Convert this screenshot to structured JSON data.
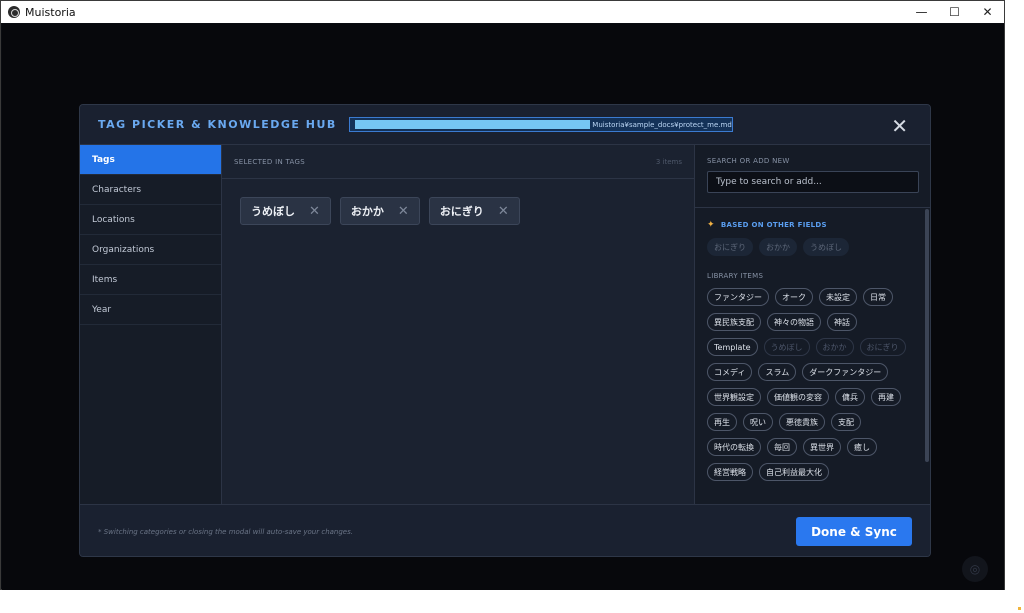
{
  "window": {
    "title": "Muistoria",
    "minimize_glyph": "—",
    "maximize_glyph": "☐",
    "close_glyph": "✕"
  },
  "modal": {
    "title": "TAG PICKER & KNOWLEDGE HUB",
    "path": "Muistoria¥sample_docs¥protect_me.md",
    "close_glyph": "✕"
  },
  "sidebar": {
    "items": [
      {
        "label": "Tags",
        "active": true
      },
      {
        "label": "Characters",
        "active": false
      },
      {
        "label": "Locations",
        "active": false
      },
      {
        "label": "Organizations",
        "active": false
      },
      {
        "label": "Items",
        "active": false
      },
      {
        "label": "Year",
        "active": false
      }
    ]
  },
  "selected": {
    "label": "SELECTED IN TAGS",
    "count": "3 items",
    "chips": [
      {
        "label": "うめぼし"
      },
      {
        "label": "おかか"
      },
      {
        "label": "おにぎり"
      }
    ],
    "remove_glyph": "✕"
  },
  "search": {
    "label": "SEARCH OR ADD NEW",
    "placeholder": "Type to search or add..."
  },
  "suggestions": {
    "title": "BASED ON OTHER FIELDS",
    "items": [
      "おにぎり",
      "おかか",
      "うめぼし"
    ]
  },
  "library": {
    "title": "LIBRARY ITEMS",
    "items": [
      {
        "label": "ファンタジー",
        "dim": false
      },
      {
        "label": "オーク",
        "dim": false
      },
      {
        "label": "未設定",
        "dim": false
      },
      {
        "label": "日常",
        "dim": false
      },
      {
        "label": "異民族支配",
        "dim": false
      },
      {
        "label": "神々の物語",
        "dim": false
      },
      {
        "label": "神話",
        "dim": false
      },
      {
        "label": "Template",
        "dim": false
      },
      {
        "label": "うめぼし",
        "dim": true
      },
      {
        "label": "おかか",
        "dim": true
      },
      {
        "label": "おにぎり",
        "dim": true
      },
      {
        "label": "コメディ",
        "dim": false
      },
      {
        "label": "スラム",
        "dim": false
      },
      {
        "label": "ダークファンタジー",
        "dim": false
      },
      {
        "label": "世界観設定",
        "dim": false
      },
      {
        "label": "価値観の変容",
        "dim": false
      },
      {
        "label": "傭兵",
        "dim": false
      },
      {
        "label": "再建",
        "dim": false
      },
      {
        "label": "再生",
        "dim": false
      },
      {
        "label": "呪い",
        "dim": false
      },
      {
        "label": "悪徳貴族",
        "dim": false
      },
      {
        "label": "支配",
        "dim": false
      },
      {
        "label": "時代の転換",
        "dim": false
      },
      {
        "label": "毎回",
        "dim": false
      },
      {
        "label": "異世界",
        "dim": false
      },
      {
        "label": "癒し",
        "dim": false
      },
      {
        "label": "経営戦略",
        "dim": false
      },
      {
        "label": "自己利益最大化",
        "dim": false
      }
    ]
  },
  "footer": {
    "note": "* Switching categories or closing the modal will auto-save your changes.",
    "done_label": "Done & Sync"
  },
  "colors": {
    "accent": "#2a78ef",
    "title_blue": "#6aa9f0",
    "background": "#07080c"
  }
}
